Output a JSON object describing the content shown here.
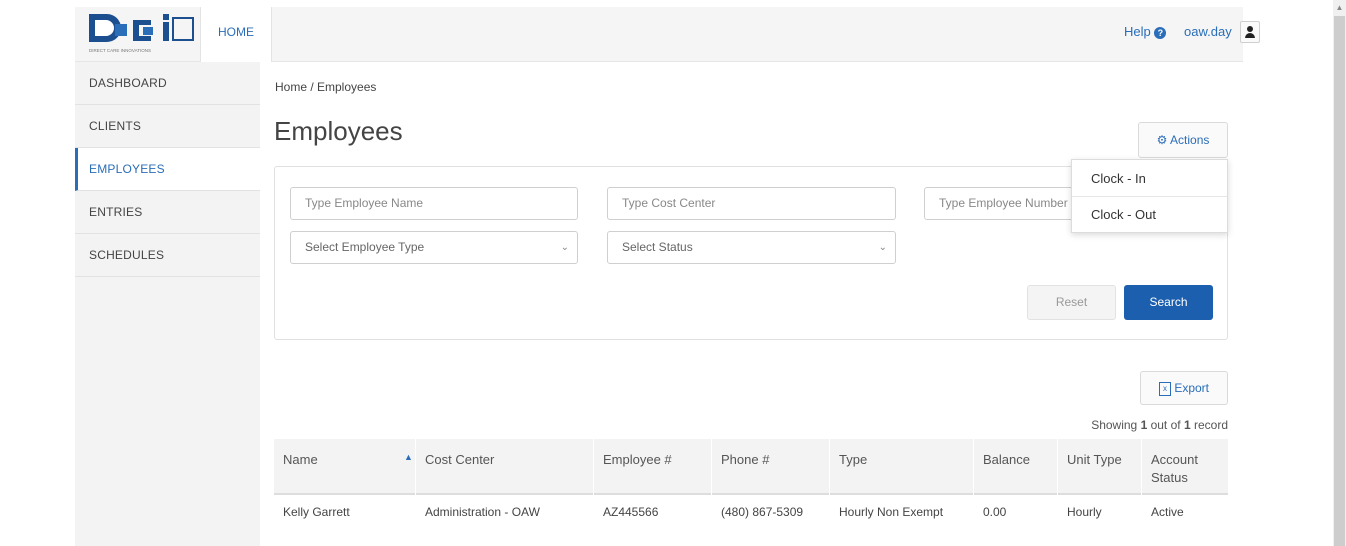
{
  "header": {
    "logo_text": "DCI",
    "logo_subtext": "DIRECT CARE INNOVATIONS",
    "home_label": "HOME",
    "help_label": "Help",
    "username": "oaw.day"
  },
  "sidebar": {
    "items": [
      {
        "label": "DASHBOARD"
      },
      {
        "label": "CLIENTS"
      },
      {
        "label": "EMPLOYEES",
        "active": true
      },
      {
        "label": "ENTRIES"
      },
      {
        "label": "SCHEDULES"
      }
    ]
  },
  "breadcrumb": "Home / Employees",
  "page_title": "Employees",
  "actions": {
    "label": "Actions",
    "menu": [
      {
        "label": "Clock - In"
      },
      {
        "label": "Clock - Out"
      }
    ]
  },
  "filters": {
    "employee_name_placeholder": "Type Employee Name",
    "cost_center_placeholder": "Type Cost Center",
    "employee_number_placeholder": "Type Employee Number",
    "employee_type_select": "Select Employee Type",
    "status_select": "Select Status",
    "reset_label": "Reset",
    "search_label": "Search"
  },
  "export_label": "Export",
  "showing": {
    "prefix": "Showing ",
    "count": "1",
    "middle": " out of ",
    "total": "1",
    "suffix": " record"
  },
  "table": {
    "columns": [
      "Name",
      "Cost Center",
      "Employee #",
      "Phone #",
      "Type",
      "Balance",
      "Unit Type",
      "Account Status"
    ],
    "rows": [
      [
        "Kelly Garrett",
        "Administration - OAW",
        "AZ445566",
        "(480) 867-5309",
        "Hourly Non Exempt",
        "0.00",
        "Hourly",
        "Active"
      ]
    ]
  },
  "colors": {
    "accent": "#2a6db8",
    "primary_button": "#1c5fae",
    "sidebar_bg": "#f3f3f3"
  }
}
